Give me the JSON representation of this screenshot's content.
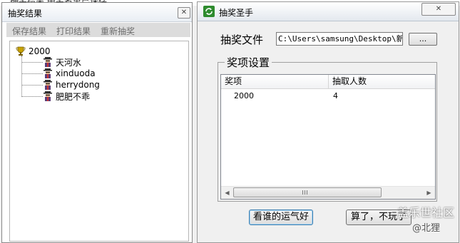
{
  "background": {
    "partial_text": "抽奖结果 中奖名单已保存"
  },
  "results_window": {
    "title": "抽奖结果",
    "close_glyph": "✕",
    "toolbar": [
      "保存结果",
      "打印结果",
      "重新抽奖"
    ],
    "tree": {
      "root": "2000",
      "winners": [
        "天河水",
        "xinduoda",
        "herrydong",
        "肥肥不乖"
      ]
    }
  },
  "lottery_window": {
    "title": "抽奖圣手",
    "close_glyph": "✕",
    "file_label": "抽奖文件",
    "file_path": "C:\\Users\\samsung\\Desktop\\新建",
    "browse_label": "...",
    "group_title": "奖项设置",
    "columns": [
      "奖项",
      "抽取人数"
    ],
    "rows": [
      {
        "prize": "2000",
        "count": "4"
      }
    ],
    "draw_button": "看谁的运气好",
    "quit_button": "算了，不玩了"
  },
  "watermark": {
    "site": "盖乐世社区",
    "user": "@北狸"
  },
  "colors": {
    "accent": "#3c7fb1",
    "tree_line": "#777777"
  },
  "icons": {
    "trophy": "trophy-icon",
    "winner": "winner-person-icon",
    "app": "app-icon"
  }
}
